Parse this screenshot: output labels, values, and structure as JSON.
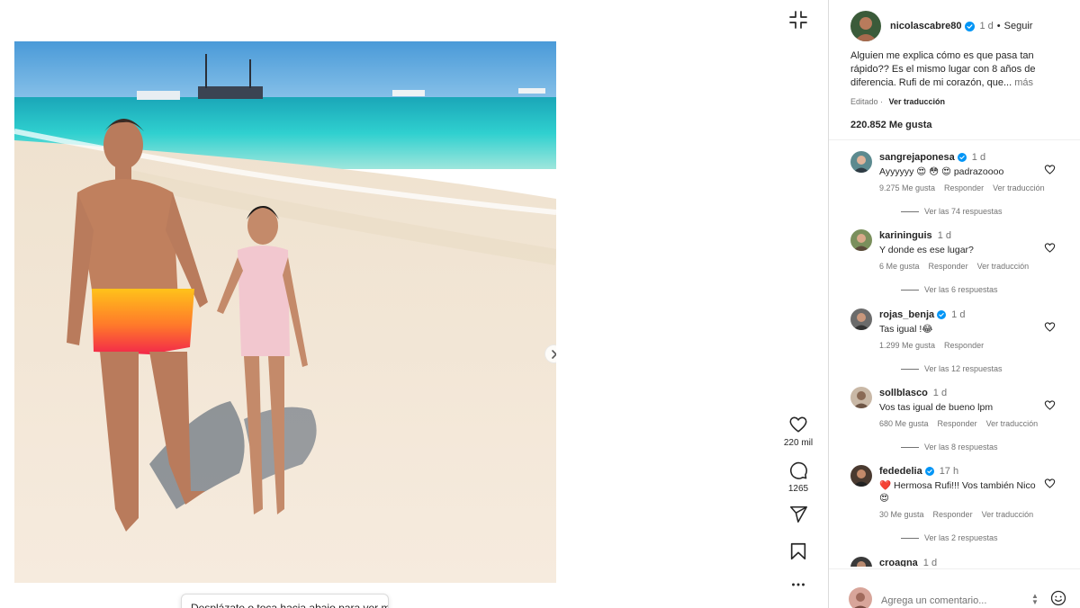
{
  "post": {
    "author": "nicolascabre80",
    "time": "1 d",
    "dot": "•",
    "follow": "Seguir",
    "caption": "Alguien me explica cómo es que pasa tan rápido?? Es el mismo lugar con 8 años de diferencia. Rufi de mi corazón, que...",
    "caption_more": "más",
    "edited": "Editado",
    "see_translation": "Ver traducción",
    "likes": "220.852 Me gusta"
  },
  "actions": {
    "likes_count": "220 mil",
    "comments_count": "1265"
  },
  "scroll_hint": "Desplázate o toca hacia abajo para ver más",
  "comments": [
    {
      "user": "sangrejaponesa",
      "verified": true,
      "time": "1 d",
      "text": "Ayyyyyy 😍 😳 😍 padrazoooo",
      "likes": "9.275 Me gusta",
      "reply": "Responder",
      "translate": "Ver traducción",
      "replies": "Ver las 74 respuestas"
    },
    {
      "user": "karininguis",
      "verified": false,
      "time": "1 d",
      "text": "Y donde es ese lugar?",
      "likes": "6 Me gusta",
      "reply": "Responder",
      "translate": "Ver traducción",
      "replies": "Ver las 6 respuestas"
    },
    {
      "user": "rojas_benja",
      "verified": true,
      "time": "1 d",
      "text": "Tas igual !😂",
      "likes": "1.299 Me gusta",
      "reply": "Responder",
      "translate": "",
      "replies": "Ver las 12 respuestas"
    },
    {
      "user": "sollblasco",
      "verified": false,
      "time": "1 d",
      "text": "Vos tas igual de bueno lpm",
      "likes": "680 Me gusta",
      "reply": "Responder",
      "translate": "Ver traducción",
      "replies": "Ver las 8 respuestas"
    },
    {
      "user": "fededelia",
      "verified": true,
      "time": "17 h",
      "text": "❤️ Hermosa Rufi!!! Vos también Nico 😍",
      "likes": "30 Me gusta",
      "reply": "Responder",
      "translate": "Ver traducción",
      "replies": "Ver las 2 respuestas"
    },
    {
      "user": "croagna",
      "verified": false,
      "time": "1 d",
      "text": "",
      "likes": "",
      "reply": "",
      "translate": "",
      "replies": ""
    }
  ],
  "comment_box": {
    "placeholder": "Agrega un comentario..."
  },
  "colors": {
    "verified": "#0095f6",
    "text": "#262626",
    "muted": "#737373",
    "heart_red": "#ed1c24"
  },
  "icons": {
    "collapse": "collapse-icon",
    "like": "heart-icon",
    "comment": "comment-icon",
    "share": "send-icon",
    "save": "bookmark-icon",
    "more": "more-icon",
    "next": "chevron-right-icon",
    "emoji": "emoji-icon"
  }
}
